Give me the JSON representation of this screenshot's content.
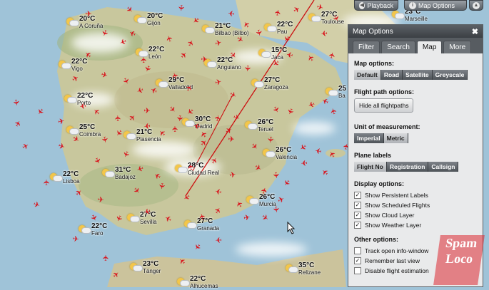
{
  "toolbar": {
    "playback_label": "Playback",
    "map_options_label": "Map Options"
  },
  "panel": {
    "title": "Map Options",
    "tabs": [
      "Filter",
      "Search",
      "Map",
      "More"
    ],
    "active_tab": "Map",
    "map_options": {
      "heading": "Map options:",
      "choices": [
        "Default",
        "Road",
        "Satellite",
        "Greyscale"
      ],
      "selected": "Default"
    },
    "flight_path": {
      "heading": "Flight path options:",
      "button": "Hide all flightpaths"
    },
    "unit": {
      "heading": "Unit of measurement:",
      "choices": [
        "Imperial",
        "Metric"
      ],
      "selected": "Metric"
    },
    "plane_labels": {
      "heading": "Plane labels",
      "choices": [
        "Flight No",
        "Registration",
        "Callsign"
      ],
      "selected": "Flight No"
    },
    "display": {
      "heading": "Display options:",
      "items": [
        {
          "label": "Show Persistent Labels",
          "checked": true
        },
        {
          "label": "Show Scheduled Flights",
          "checked": true
        },
        {
          "label": "Show Cloud Layer",
          "checked": true
        },
        {
          "label": "Show Weather Layer",
          "checked": true
        }
      ]
    },
    "other": {
      "heading": "Other options:",
      "items": [
        {
          "label": "Track open info-window",
          "checked": false
        },
        {
          "label": "Remember last view",
          "checked": true
        },
        {
          "label": "Disable flight estimation",
          "checked": false
        }
      ]
    }
  },
  "weather": [
    {
      "temp": "20°C",
      "city": "A Coruña"
    },
    {
      "temp": "20°C",
      "city": "Gijón"
    },
    {
      "temp": "21°C",
      "city": "Bilbao (Bilbo)"
    },
    {
      "temp": "22°C",
      "city": "Pau"
    },
    {
      "temp": "27°C",
      "city": "Toulouse"
    },
    {
      "temp": "23°C",
      "city": "Marseille"
    },
    {
      "temp": "22°C",
      "city": "León"
    },
    {
      "temp": "22°C",
      "city": "Anguiano"
    },
    {
      "temp": "15°C",
      "city": "Jaca"
    },
    {
      "temp": "22°C",
      "city": "Vigo"
    },
    {
      "temp": "29°C",
      "city": "Valladolid"
    },
    {
      "temp": "27°C",
      "city": "Zaragoza"
    },
    {
      "temp": "25",
      "city": "Ba"
    },
    {
      "temp": "22°C",
      "city": "Porto"
    },
    {
      "temp": "30°C",
      "city": "Madrid"
    },
    {
      "temp": "25°C",
      "city": "Coimbra"
    },
    {
      "temp": "21°C",
      "city": "Plasencia"
    },
    {
      "temp": "26°C",
      "city": "Teruel"
    },
    {
      "temp": "26°C",
      "city": "Valencia"
    },
    {
      "temp": "28°C",
      "city": "Ciudad Real"
    },
    {
      "temp": "22°C",
      "city": "Lisboa"
    },
    {
      "temp": "31°C",
      "city": "Badajoz"
    },
    {
      "temp": "26°C",
      "city": "Murcia"
    },
    {
      "temp": "22°C",
      "city": "Faro"
    },
    {
      "temp": "27°C",
      "city": "Sevilla"
    },
    {
      "temp": "27°C",
      "city": "Granada"
    },
    {
      "temp": "23°C",
      "city": "Tánger"
    },
    {
      "temp": "22°C",
      "city": "Alhucemas"
    },
    {
      "temp": "35°C",
      "city": "Relizane"
    }
  ],
  "watermark": {
    "lines": [
      "Spam",
      "Loco"
    ]
  },
  "colors": {
    "plane": "#d9121b",
    "flightpath": "#cc1010",
    "sea": "#9fc3d8",
    "land": "#c9c9a0"
  }
}
